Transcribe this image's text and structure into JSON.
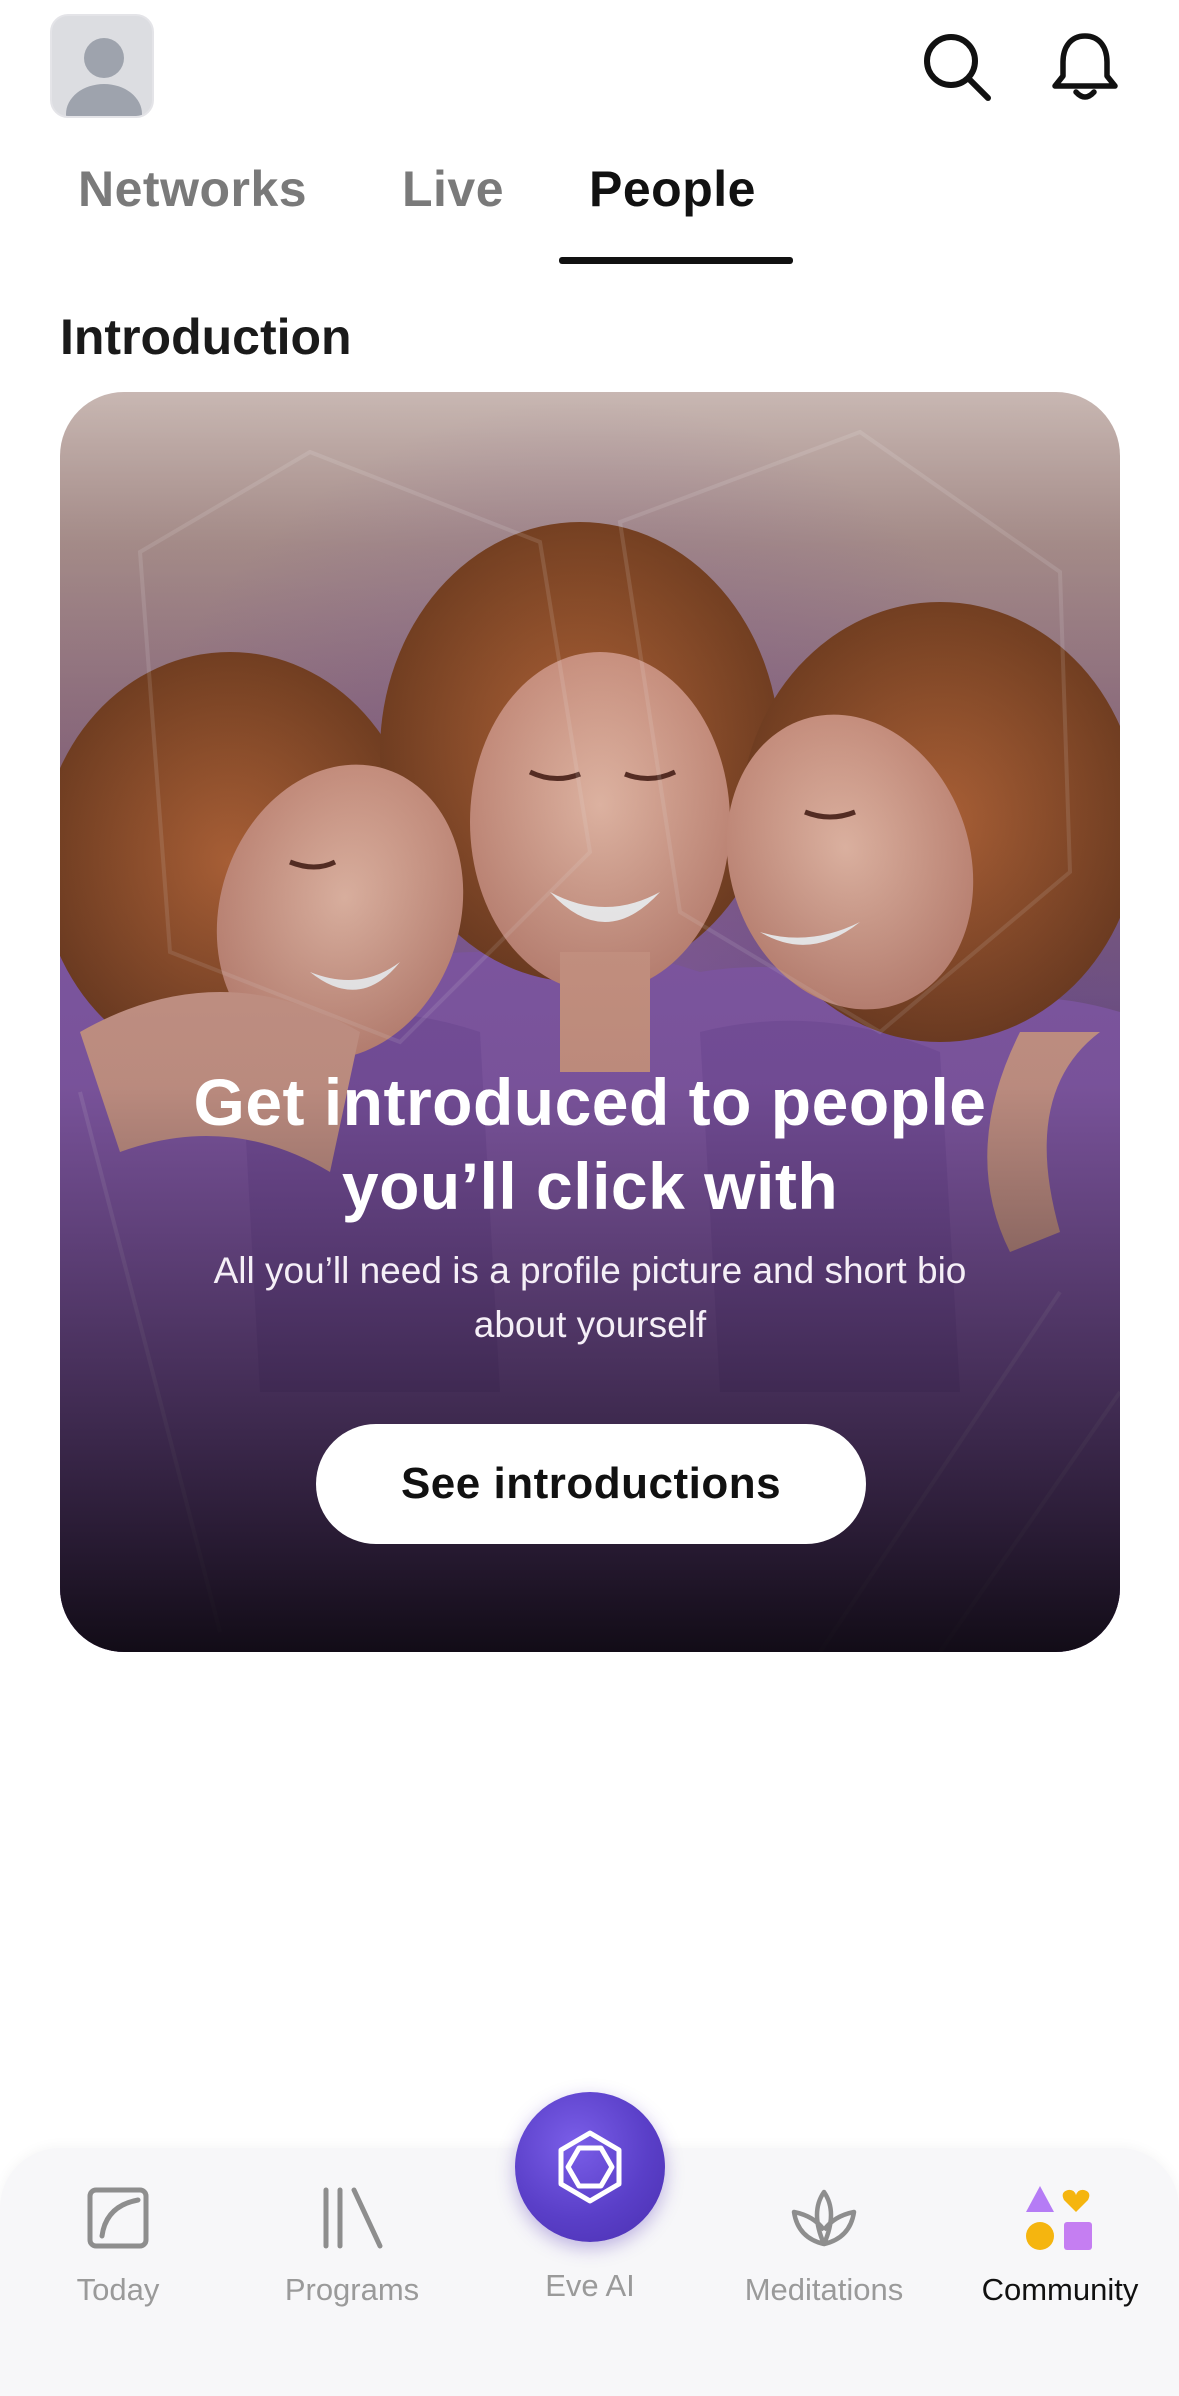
{
  "header": {
    "avatar_icon": "profile-avatar-icon",
    "search_icon": "search-icon",
    "notifications_icon": "bell-icon"
  },
  "tabs": [
    {
      "label": "Networks",
      "active": false
    },
    {
      "label": "Live",
      "active": false
    },
    {
      "label": "People",
      "active": true
    }
  ],
  "section": {
    "title": "Introduction"
  },
  "card": {
    "title_line1": "Get introduced to people",
    "title_line2": "you’ll click with",
    "subtitle_line1": "All you’ll need is a profile picture and short bio",
    "subtitle_line2": "about yourself",
    "cta_label": "See introductions",
    "image_description_icon": "three-women-laughing-photo"
  },
  "bottom_nav": {
    "items": [
      {
        "label": "Today",
        "icon": "today-icon",
        "active": false
      },
      {
        "label": "Programs",
        "icon": "programs-icon",
        "active": false
      },
      {
        "label": "Eve AI",
        "icon": "eve-ai-icon",
        "active": false
      },
      {
        "label": "Meditations",
        "icon": "lotus-icon",
        "active": false
      },
      {
        "label": "Community",
        "icon": "community-shapes-icon",
        "active": true
      }
    ],
    "accent_color": "#5a3fc8",
    "community_colors": [
      "#b57cf5",
      "#f5b50f",
      "#f5b50f",
      "#c57ef2"
    ]
  }
}
